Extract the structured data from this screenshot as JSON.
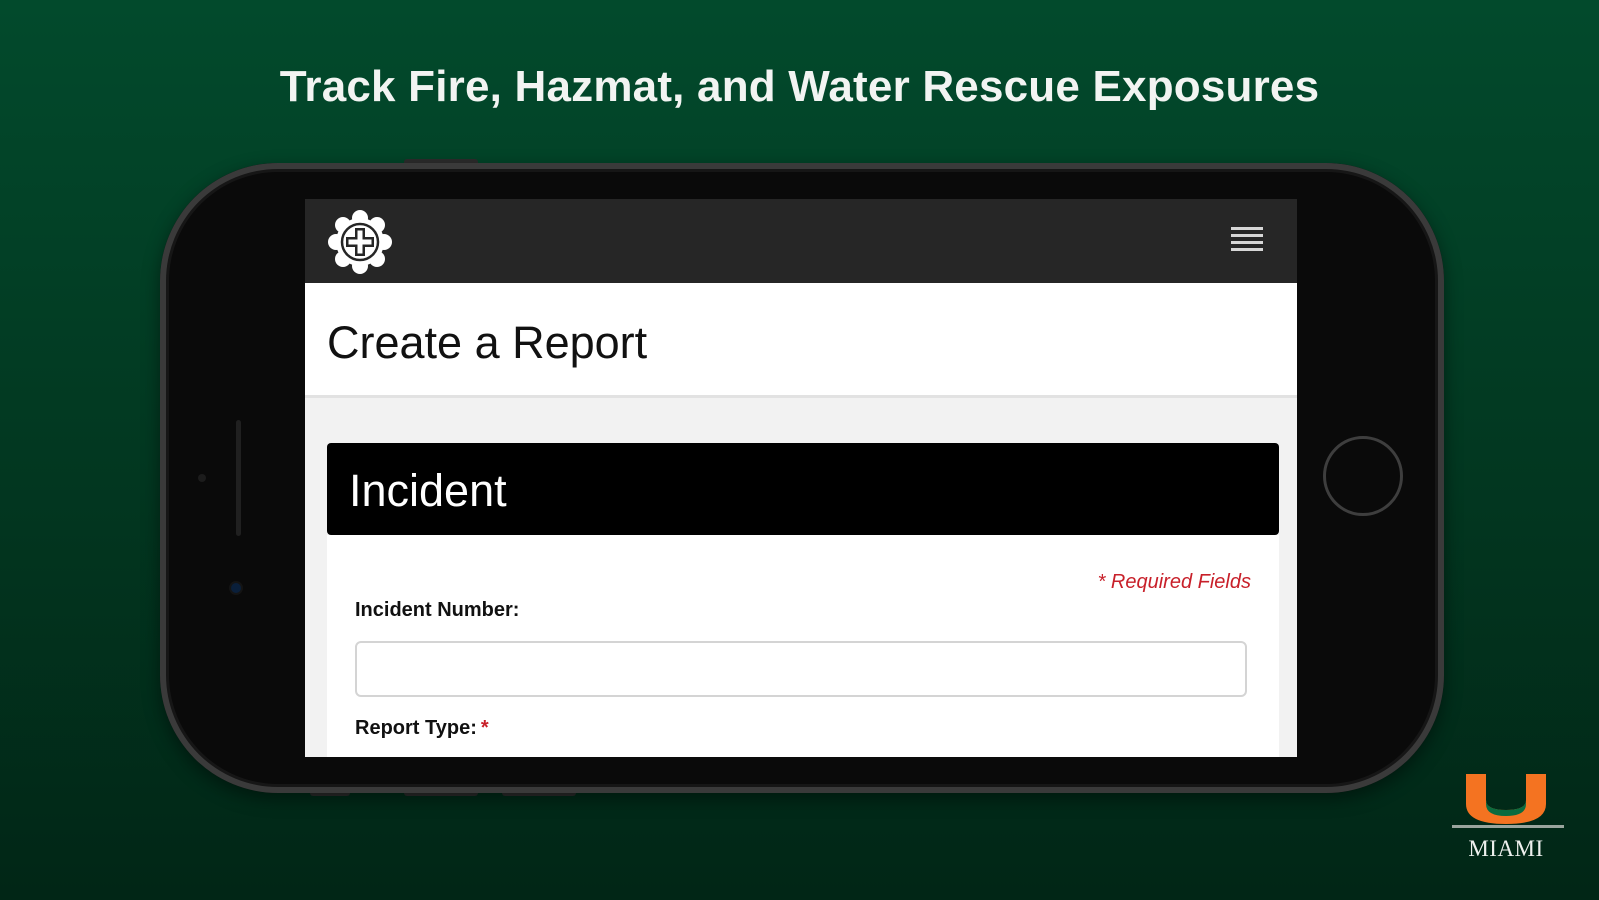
{
  "headline": "Track Fire, Hazmat, and Water Rescue Exposures",
  "app_bar": {
    "logo_icon": "cross-badge-icon",
    "menu_icon": "hamburger-menu-icon"
  },
  "page": {
    "title": "Create a Report"
  },
  "section": {
    "title": "Incident",
    "required_note": "* Required Fields",
    "fields": [
      {
        "label": "Incident Number:",
        "value": "",
        "required": false
      },
      {
        "label": "Report Type:",
        "required_marker": "*",
        "required": true
      }
    ]
  },
  "brand": {
    "wordmark": "MIAMI",
    "logo_icon": "u-letter-logo",
    "logo_color": "#f47321"
  },
  "colors": {
    "background": "#024a2c",
    "app_bar": "#262626",
    "section_header": "#000000",
    "required": "#c8202a"
  }
}
